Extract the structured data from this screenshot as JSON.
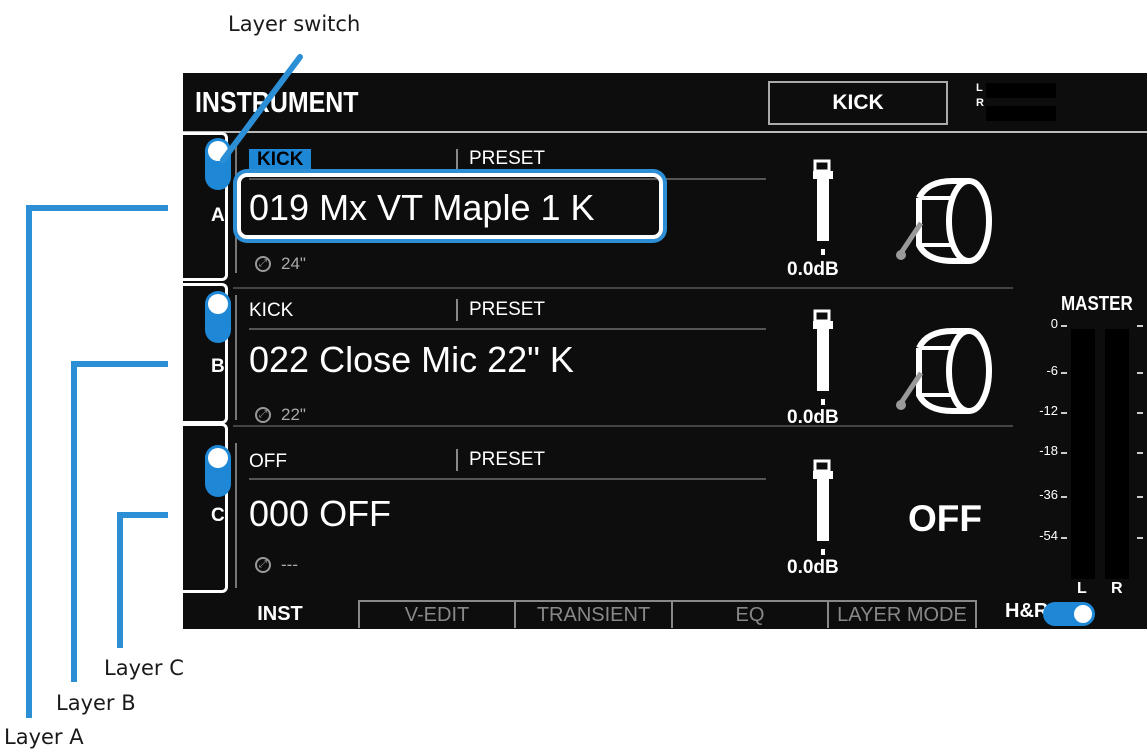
{
  "callouts": {
    "layer_switch": "Layer switch",
    "layer_a": "Layer A",
    "layer_b": "Layer B",
    "layer_c": "Layer C"
  },
  "header": {
    "title": "INSTRUMENT",
    "instrument_name": "KICK",
    "meter_l": "L",
    "meter_r": "R"
  },
  "layers": [
    {
      "letter": "A",
      "category": "KICK",
      "category_active": true,
      "preset_label": "PRESET",
      "name": "019 Mx VT Maple 1 K",
      "size": "24\"",
      "level": "0.0dB",
      "switch_on": true
    },
    {
      "letter": "B",
      "category": "KICK",
      "category_active": false,
      "preset_label": "PRESET",
      "name": "022 Close Mic 22\" K",
      "size": "22\"",
      "level": "0.0dB",
      "switch_on": true
    },
    {
      "letter": "C",
      "category": "OFF",
      "category_active": false,
      "preset_label": "PRESET",
      "name": "000 OFF",
      "size": "---",
      "level": "0.0dB",
      "switch_on": true,
      "status": "OFF"
    }
  ],
  "master": {
    "title": "MASTER",
    "ticks": [
      "0",
      "-6",
      "-12",
      "-18",
      "-36",
      "-54"
    ],
    "left": "L",
    "right": "R"
  },
  "tabs": [
    {
      "label": "INST",
      "active": true
    },
    {
      "label": "V-EDIT",
      "active": false
    },
    {
      "label": "TRANSIENT",
      "active": false
    },
    {
      "label": "EQ",
      "active": false
    },
    {
      "label": "LAYER MODE",
      "active": false
    }
  ],
  "hr": {
    "label": "H&R",
    "on": true
  },
  "colors": {
    "accent": "#1e88d6",
    "screen_bg": "#0d0d0d",
    "annotation": "#2c8fd6"
  }
}
